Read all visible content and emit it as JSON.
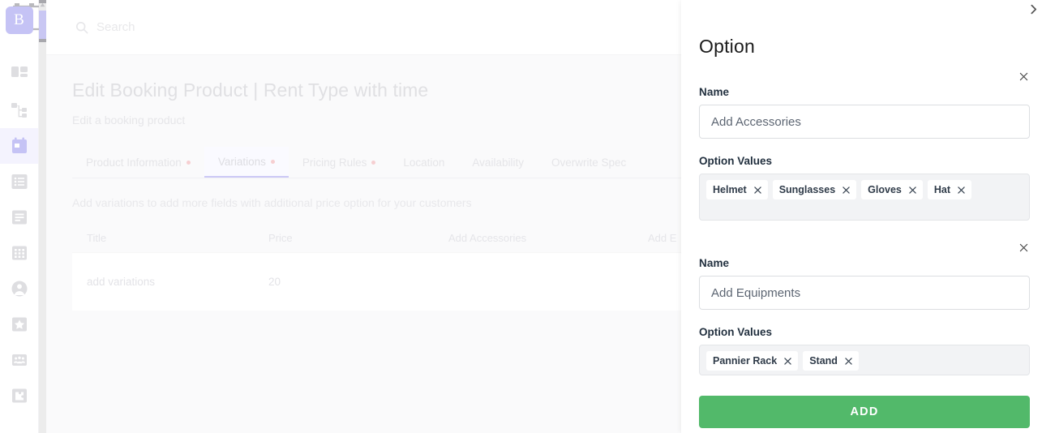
{
  "rail": {
    "logo_letter": "B",
    "items": [
      {
        "name": "dashboard",
        "icon": "dashboard-icon"
      },
      {
        "name": "sitemap",
        "icon": "sitemap-icon"
      },
      {
        "name": "bookings",
        "icon": "calendar-booking-icon",
        "active": true
      },
      {
        "name": "list",
        "icon": "list-icon"
      },
      {
        "name": "document",
        "icon": "document-icon"
      },
      {
        "name": "grid",
        "icon": "grid-icon"
      },
      {
        "name": "account",
        "icon": "user-circle-icon"
      },
      {
        "name": "favorites",
        "icon": "star-icon"
      },
      {
        "name": "customers",
        "icon": "users-group-icon"
      },
      {
        "name": "addons",
        "icon": "puzzle-icon"
      }
    ]
  },
  "topbar": {
    "search_placeholder": "Search",
    "search_value": ""
  },
  "page": {
    "title": "Edit Booking Product | Rent Type with time",
    "subtitle": "Edit a booking product",
    "tabs": [
      {
        "label": "Product Information",
        "dot": true,
        "active": false
      },
      {
        "label": "Variations",
        "dot": true,
        "active": true
      },
      {
        "label": "Pricing Rules",
        "dot": true,
        "active": false
      },
      {
        "label": "Location",
        "dot": false,
        "active": false
      },
      {
        "label": "Availability",
        "dot": false,
        "active": false
      },
      {
        "label": "Overwrite Spec",
        "dot": false,
        "active": false
      }
    ],
    "hint": "Add variations to add more fields with additional price option for your customers",
    "table": {
      "headers": [
        "Title",
        "Price",
        "Add Accessories",
        "Add E"
      ],
      "rows": [
        [
          "add variations",
          "20",
          "",
          ""
        ]
      ]
    }
  },
  "panel": {
    "title": "Option",
    "collapse_icon": "chevron-right-icon",
    "name_label": "Name",
    "values_label": "Option Values",
    "options": [
      {
        "name_value": "Add Accessories",
        "values": [
          "Helmet",
          "Sunglasses",
          "Gloves",
          "Hat"
        ]
      },
      {
        "name_value": "Add Equipments",
        "values": [
          "Pannier Rack",
          "Stand"
        ]
      }
    ],
    "add_label": "ADD"
  },
  "colors": {
    "accent": "#c5c3f5",
    "add_button": "#52b96a",
    "tab_dot": "#f6cfd1"
  }
}
